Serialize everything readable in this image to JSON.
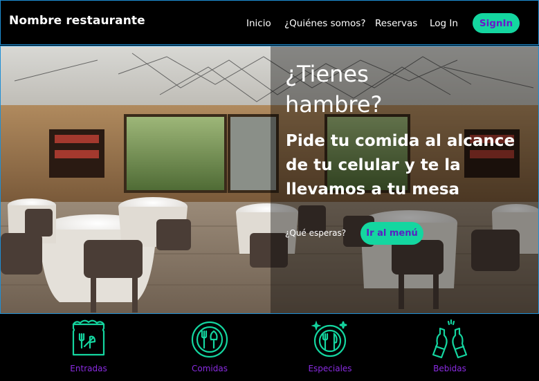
{
  "navbar": {
    "brand": "Nombre restaurante",
    "links": [
      "Inicio",
      "¿Quiénes somos?",
      "Reservas",
      "Log In"
    ],
    "signin_label": "SignIn"
  },
  "hero": {
    "title": "¿Tienes hambre?",
    "subtitle": "Pide tu comida al alcance de tu celular y te la llevamos a tu mesa",
    "question": "¿Qué esperas?",
    "menu_button": "Ir al menú"
  },
  "categories": [
    {
      "label": "Entradas",
      "icon": "menu-board-icon"
    },
    {
      "label": "Comidas",
      "icon": "plate-cutlery-icon"
    },
    {
      "label": "Especiales",
      "icon": "special-plate-icon"
    },
    {
      "label": "Bebidas",
      "icon": "beer-bottles-icon"
    }
  ],
  "colors": {
    "accent": "#14d6a0",
    "purple": "#8a2be2",
    "navbar": "#000000",
    "border": "#1e8fd6"
  }
}
